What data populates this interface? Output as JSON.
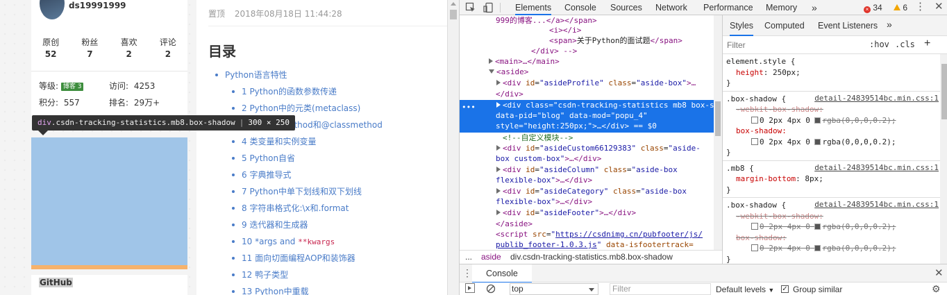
{
  "profile": {
    "username": "ds19991999",
    "stats": [
      {
        "label": "原创",
        "value": "52"
      },
      {
        "label": "粉丝",
        "value": "7"
      },
      {
        "label": "喜欢",
        "value": "2"
      },
      {
        "label": "评论",
        "value": "2"
      }
    ],
    "level_label": "等级:",
    "level_badge": "博客 3",
    "visits_label": "访问:",
    "visits_value": "4253",
    "points_label": "积分:",
    "points_value": "557",
    "rank_label": "排名:",
    "rank_value": "29万+"
  },
  "tooltip": {
    "tag": "div",
    "classes": ".csdn-tracking-statistics.mb8.box-shadow",
    "size": "300 × 250"
  },
  "github_label": "GitHub",
  "article": {
    "pinned": "置顶",
    "date": "2018年08月18日 11:44:28",
    "toc_title": "目录",
    "toc": [
      {
        "level": 1,
        "text": "Python语言特性"
      },
      {
        "level": 2,
        "text": "1 Python的函数参数传递"
      },
      {
        "level": 2,
        "text": "2 Python中的元类(metaclass)"
      },
      {
        "level": 2,
        "text": "3 @staticmethod和@classmethod"
      },
      {
        "level": 2,
        "text": "4 类变量和实例变量"
      },
      {
        "level": 2,
        "text": "5 Python自省"
      },
      {
        "level": 2,
        "text": "6 字典推导式"
      },
      {
        "level": 2,
        "text": "7 Python中单下划线和双下划线"
      },
      {
        "level": 2,
        "text": "8 字符串格式化:\\x和.format"
      },
      {
        "level": 2,
        "text": "9 迭代器和生成器"
      },
      {
        "level": 2,
        "text": "10 *args and ",
        "code": "**kwargs"
      },
      {
        "level": 2,
        "text": "11 面向切面编程AOP和装饰器"
      },
      {
        "level": 2,
        "text": "12 鸭子类型"
      },
      {
        "level": 2,
        "text": "13 Python中重载"
      }
    ]
  },
  "devtools": {
    "tabs": [
      "Elements",
      "Console",
      "Sources",
      "Network",
      "Performance",
      "Memory"
    ],
    "more_tabs": "»",
    "error_count": "34",
    "warning_count": "6",
    "dom": {
      "line0": "999的博客...</a></span>",
      "line1": "<i></i>",
      "line2_open": "<span>",
      "line2_text": "关于Python的面试题",
      "line2_close": "</span>",
      "line3": "</div> -->",
      "main": "<main>…</main>",
      "aside_open": "<aside>",
      "profile_id": "asideProfile",
      "profile_class": "aside-box",
      "div_close": "</div>",
      "sel_class": "csdn-tracking-statistics mb8 box-shadow",
      "sel_pid": "blog",
      "sel_mod": "popu_4",
      "sel_style": "height:250px;",
      "sel_tail": "…</div> == $0",
      "comment": "<!--自定义模块-->",
      "custom_id": "asideCustom66129383",
      "custom_class": "aside-box custom-box",
      "column_id": "asideColumn",
      "column_class": "aside-box flexible-box",
      "category_id": "asideCategory",
      "category_class": "aside-box flexible-box",
      "footer_id": "asideFooter",
      "aside_close": "</aside>",
      "script_src": "https://csdnimg.cn/pubfooter/js/",
      "script_src2": "publib_footer-1.0.3.js",
      "script_attr": "data-isfootertrack="
    },
    "breadcrumbs": [
      "...",
      "aside",
      "div.csdn-tracking-statistics.mb8.box-shadow"
    ],
    "styles_tabs": [
      "Styles",
      "Computed",
      "Event Listeners"
    ],
    "filter_placeholder": "Filter",
    "hov": ":hov",
    "cls": ".cls",
    "rules": {
      "element_style": "element.style {",
      "height_prop": "height",
      "height_val": "250px;",
      "box_shadow_sel": ".box-shadow {",
      "src1": "detail-24839514bc.min.css:1",
      "webkit_prop": "-webkit-box-shadow:",
      "shadow_val": "0 2px 4px 0",
      "rgba_val": "rgba(0,0,0,0.2);",
      "box_shadow_prop": "box-shadow:",
      "mb8_sel": ".mb8 {",
      "margin_prop": "margin-bottom",
      "margin_val": "8px;",
      "close": "}"
    },
    "console_tab": "Console",
    "console_context": "top",
    "console_filter": "Filter",
    "default_levels": "Default levels",
    "group_similar": "Group similar"
  },
  "colors": {
    "accent": "#1a73e8",
    "link": "#4a7cc8",
    "highlight": "#a0c5e8"
  }
}
